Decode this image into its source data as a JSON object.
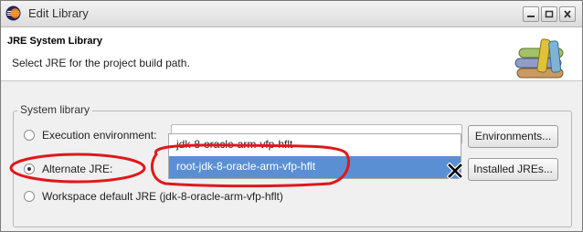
{
  "window": {
    "title": "Edit Library"
  },
  "header": {
    "title": "JRE System Library",
    "description": "Select JRE for the project build path."
  },
  "group": {
    "label": "System library",
    "options": [
      {
        "label": "Execution environment:",
        "checked": false
      },
      {
        "label": "Alternate JRE:",
        "checked": true
      },
      {
        "label": "Workspace default JRE (jdk-8-oracle-arm-vfp-hflt)",
        "checked": false
      }
    ],
    "execution_environment_value": "",
    "alternate_jre_dropdown": {
      "items": [
        {
          "label": "jdk-8-oracle-arm-vfp-hflt",
          "selected": false
        },
        {
          "label": "root-jdk-8-oracle-arm-vfp-hflt",
          "selected": true
        }
      ]
    },
    "buttons": {
      "environments": "Environments...",
      "installed_jres": "Installed JREs..."
    }
  },
  "annotations": {
    "color": "#e0181b"
  },
  "icons": {
    "app": "eclipse-icon",
    "header": "books-icon",
    "cursor": "x-cursor-icon"
  }
}
